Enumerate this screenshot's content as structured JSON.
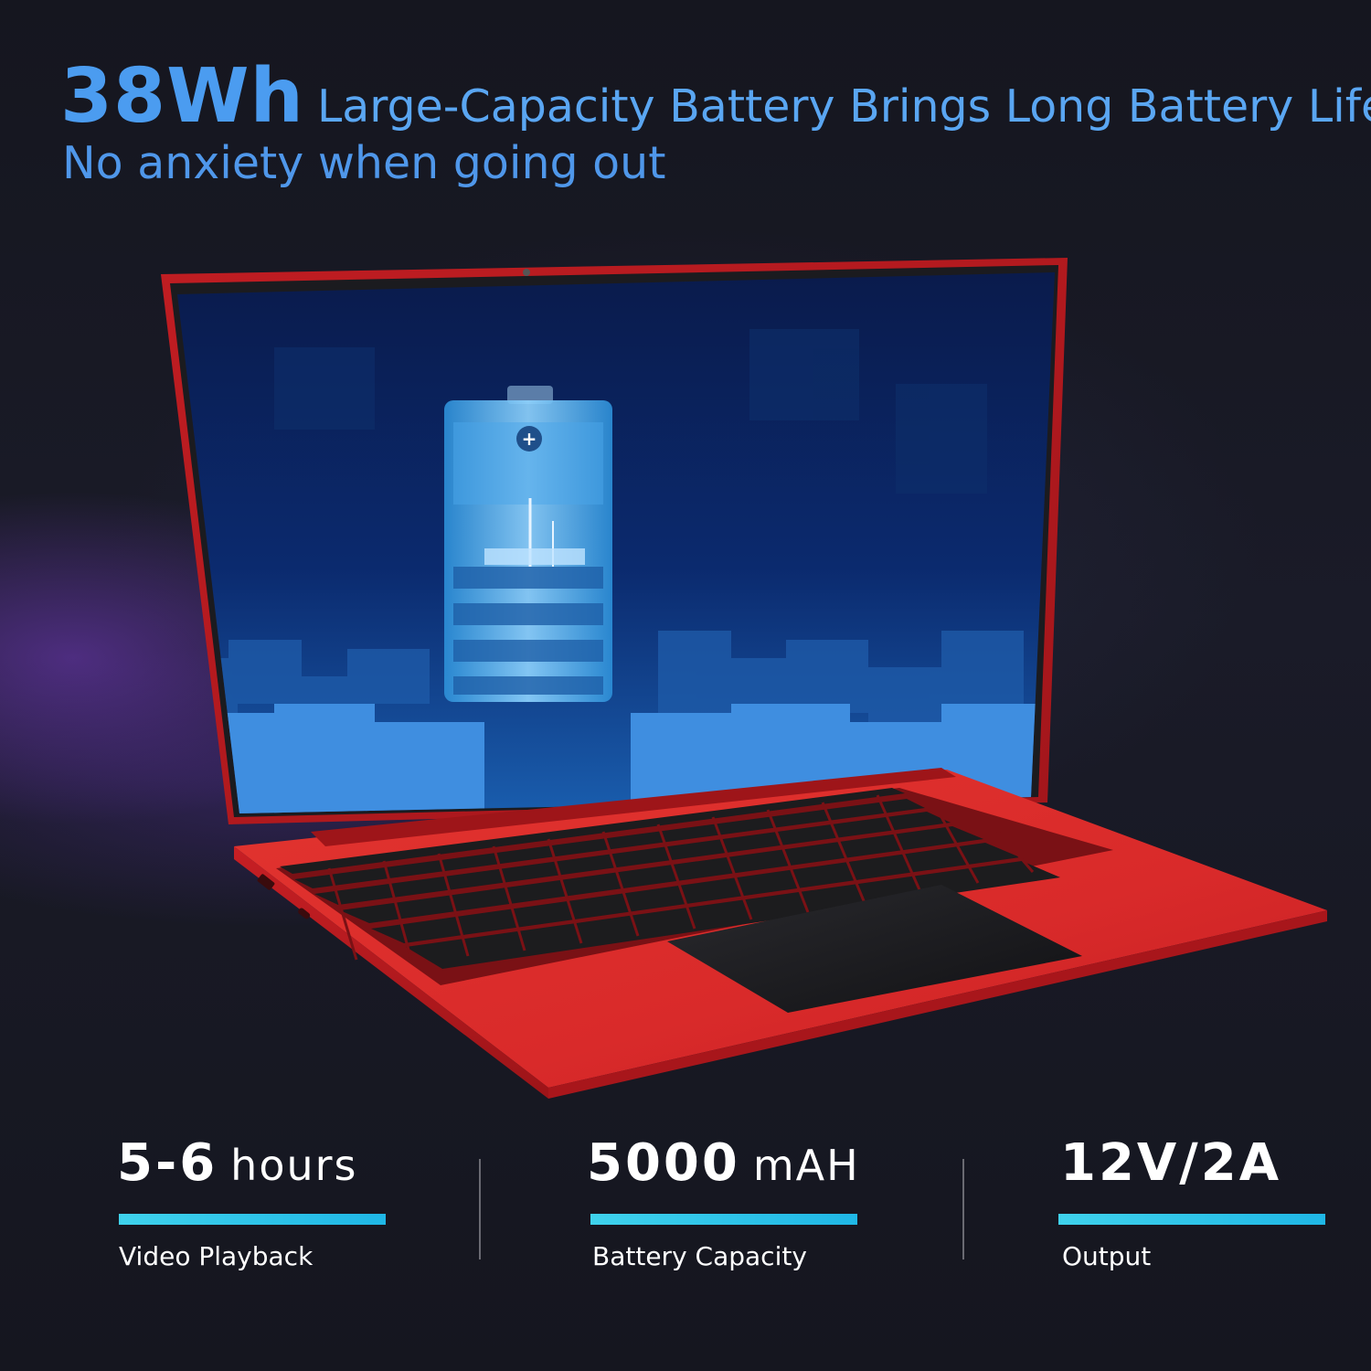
{
  "headline": {
    "emphasis": "38Wh",
    "rest": "Large-Capacity Battery Brings Long Battery Life",
    "subtitle": "No anxiety when going out"
  },
  "stats": [
    {
      "value": "5-6",
      "unit": "hours",
      "label": "Video Playback"
    },
    {
      "value": "5000",
      "unit": "mAH",
      "label": "Battery Capacity"
    },
    {
      "value": "12V/2A",
      "unit": "",
      "label": "Output"
    }
  ],
  "colors": {
    "headline": "#4b9cf0",
    "laptop_body": "#d8252a",
    "accent_bar": "#2fc6ea",
    "background": "#15161f"
  },
  "images": {
    "product": "red-laptop-illustration",
    "screen": "battery-charging-illustration"
  }
}
